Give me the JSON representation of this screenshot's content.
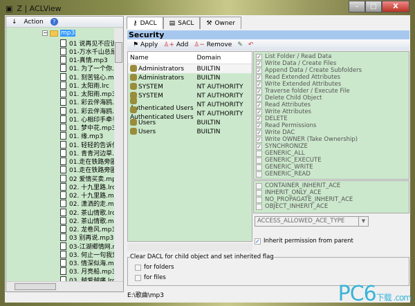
{
  "window": {
    "title": "Z | ACLView",
    "minimize": "–",
    "maximize": "□",
    "close": "X"
  },
  "left": {
    "toolbar": {
      "arrow": "↓",
      "action": "Action",
      "help": "?"
    },
    "folder": "mp3",
    "expander": "−",
    "items": [
      "01 说再见不应该",
      "01-万水千山总是",
      "01-真情.mp3",
      "01. 为了一个你.m",
      "01. 刻苦铭心.mp3",
      "01. 太阳雨.lrc",
      "01. 太阳雨.mp3",
      "01. 彩云伴海鸥.lr",
      "01. 彩云伴海鸥.m",
      "01. 心相印手牵手",
      "01. 梦中花.mp3",
      "01. 缘.mp3",
      "01. 轻轻的告诉你",
      "01. 青青河边草.m",
      "01.走在铁路旁匿",
      "01.走在铁路旁匿",
      "02 爱情买卖.mp3",
      "02. 十九里路.lrc",
      "02. 十九里路.mp3",
      "02. 潇洒的走.mp3",
      "02. 茶山情歌.lrc",
      "02. 茶山情歌.mp3",
      "02. 龙卷风.mp3",
      "03 别再说.mp3",
      "03-江湖郷情网.m",
      "03. 何止一句我爱",
      "03. 情深似海.mp3",
      "03. 月亮船.mp3",
      "03. 越爱越痛.lrc",
      "03. 越爱越痛.mp3"
    ]
  },
  "tabs": [
    {
      "label": "DACL",
      "active": true
    },
    {
      "label": "SACL"
    },
    {
      "label": "Owner"
    }
  ],
  "security": {
    "header": "Security",
    "apply": "Apply",
    "add": "Add",
    "remove": "Remove"
  },
  "list": {
    "columns": [
      "Name",
      "Domain"
    ],
    "rows": [
      [
        "Administrators",
        "BUILTIN"
      ],
      [
        "Administrators",
        "BUILTIN"
      ],
      [
        "SYSTEM",
        "NT AUTHORITY"
      ],
      [
        "SYSTEM",
        "NT AUTHORITY"
      ],
      [
        "Authenticated Users",
        "NT AUTHORITY"
      ],
      [
        "Authenticated Users",
        "NT AUTHORITY"
      ],
      [
        "Users",
        "BUILTIN"
      ],
      [
        "Users",
        "BUILTIN"
      ]
    ]
  },
  "permissions": [
    {
      "label": "List Folder / Read Data",
      "checked": true
    },
    {
      "label": "Write Data / Create Files",
      "checked": true
    },
    {
      "label": "Append Data / Create Subfolders",
      "checked": true
    },
    {
      "label": "Read Extended Attributes",
      "checked": true
    },
    {
      "label": "Write Extended Attributes",
      "checked": true
    },
    {
      "label": "Traverse folder / Execute File",
      "checked": true
    },
    {
      "label": "Delete Child Object",
      "checked": true
    },
    {
      "label": "Read Attributes",
      "checked": true
    },
    {
      "label": "Write Attributes",
      "checked": true
    },
    {
      "label": "DELETE",
      "checked": true
    },
    {
      "label": "Read Permissions",
      "checked": true
    },
    {
      "label": "Write DAC",
      "checked": true
    },
    {
      "label": "Write OWNER (Take Ownership)",
      "checked": true
    },
    {
      "label": "SYNCHRONIZE",
      "checked": true
    },
    {
      "label": "GENERIC_ALL",
      "checked": false
    },
    {
      "label": "GENERIC_EXECUTE",
      "checked": false
    },
    {
      "label": "GENERIC_WRITE",
      "checked": false
    },
    {
      "label": "GENERIC_READ",
      "checked": false
    }
  ],
  "flags": [
    {
      "label": "CONTAINER_INHERIT_ACE",
      "checked": false
    },
    {
      "label": "INHERIT_ONLY_ACE",
      "checked": false
    },
    {
      "label": "NO_PROPAGATE_INHERIT_ACE",
      "checked": false
    },
    {
      "label": "OBJECT_INHERIT_ACE",
      "checked": false
    }
  ],
  "ace_type": "ACCESS_ALLOWED_ACE_TYPE",
  "inherit": {
    "label": "Inherit permission from parent",
    "checked": true
  },
  "clear_group": {
    "label": "Clear DACL for child object and set inherited flag",
    "for_folders": "for folders",
    "for_files": "for files"
  },
  "status": "E:\\歌曲\\mp3",
  "watermark": {
    "text": "PC6",
    "sub": "下载 .com"
  },
  "check_mark": "✓"
}
